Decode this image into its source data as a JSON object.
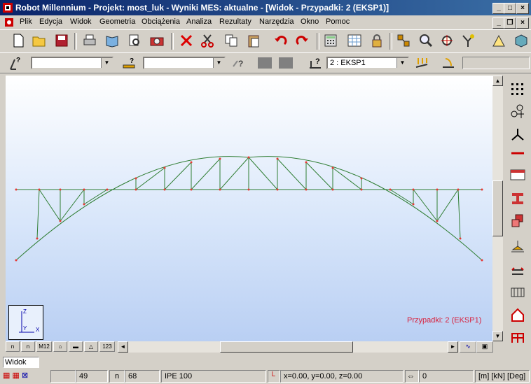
{
  "window": {
    "title": "Robot Millennium - Projekt: most_luk - Wyniki MES: aktualne - [Widok - Przypadki: 2 (EKSP1)]"
  },
  "menu": [
    "Plik",
    "Edycja",
    "Widok",
    "Geometria",
    "Obciążenia",
    "Analiza",
    "Rezultaty",
    "Narzędzia",
    "Okno",
    "Pomoc"
  ],
  "toolbar2": {
    "combo1_value": "",
    "combo2_value": "",
    "case_combo_value": "2 : EKSP1"
  },
  "view": {
    "case_label": "Przypadki: 2 (EKSP1)",
    "axis_labels": {
      "z": "Z",
      "y": "Y",
      "x": "X"
    },
    "colors": {
      "members": "#2e7d32",
      "nodes": "#e53935",
      "case_label": "#d8203c"
    }
  },
  "bottom_tabs": [
    "n",
    "n",
    "M12",
    "",
    "",
    "",
    "123"
  ],
  "command_field": "Widok",
  "status": {
    "nodes_count": "49",
    "bars_icon": "n",
    "bars_count": "68",
    "section": "IPE 100",
    "coords": "x=0.00, y=0.00, z=0.00",
    "value": "0",
    "units": "[m] [kN] [Deg]"
  }
}
